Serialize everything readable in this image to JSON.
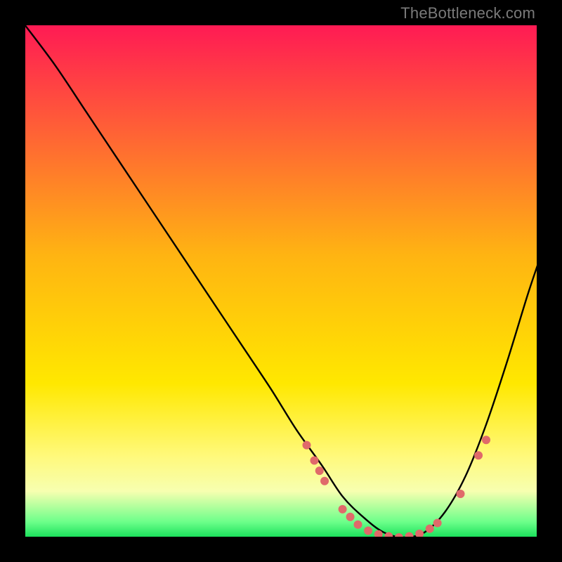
{
  "watermark": "TheBottleneck.com",
  "chart_data": {
    "type": "line",
    "title": "",
    "xlabel": "",
    "ylabel": "",
    "xlim": [
      0,
      100
    ],
    "ylim": [
      0,
      100
    ],
    "grid": false,
    "legend": false,
    "gradient_stops": [
      {
        "offset": 0,
        "color": "#ff1a54"
      },
      {
        "offset": 45,
        "color": "#ffb412"
      },
      {
        "offset": 70,
        "color": "#ffe800"
      },
      {
        "offset": 84,
        "color": "#fff97a"
      },
      {
        "offset": 91,
        "color": "#f7ffb0"
      },
      {
        "offset": 97,
        "color": "#6cff8a"
      },
      {
        "offset": 100,
        "color": "#18e05a"
      }
    ],
    "series": [
      {
        "name": "bottleneck-curve",
        "color": "#000000",
        "x": [
          0,
          6,
          12,
          18,
          24,
          30,
          36,
          42,
          48,
          53,
          58,
          62,
          66,
          70,
          74,
          78,
          82,
          86,
          90,
          94,
          98,
          100
        ],
        "y": [
          100,
          92,
          83,
          74,
          65,
          56,
          47,
          38,
          29,
          21,
          14,
          8,
          4,
          1,
          0,
          1,
          5,
          12,
          22,
          34,
          47,
          53
        ]
      }
    ],
    "markers": {
      "name": "gpu-points",
      "color": "#e06a6a",
      "radius": 6,
      "points": [
        {
          "x": 55,
          "y": 18
        },
        {
          "x": 56.5,
          "y": 15
        },
        {
          "x": 57.5,
          "y": 13
        },
        {
          "x": 58.5,
          "y": 11
        },
        {
          "x": 62,
          "y": 5.5
        },
        {
          "x": 63.5,
          "y": 4
        },
        {
          "x": 65,
          "y": 2.5
        },
        {
          "x": 67,
          "y": 1.3
        },
        {
          "x": 69,
          "y": 0.6
        },
        {
          "x": 71,
          "y": 0.2
        },
        {
          "x": 73,
          "y": 0.0
        },
        {
          "x": 75,
          "y": 0.2
        },
        {
          "x": 77,
          "y": 0.7
        },
        {
          "x": 79,
          "y": 1.7
        },
        {
          "x": 80.5,
          "y": 2.8
        },
        {
          "x": 85,
          "y": 8.5
        },
        {
          "x": 88.5,
          "y": 16
        },
        {
          "x": 90,
          "y": 19
        }
      ]
    }
  }
}
